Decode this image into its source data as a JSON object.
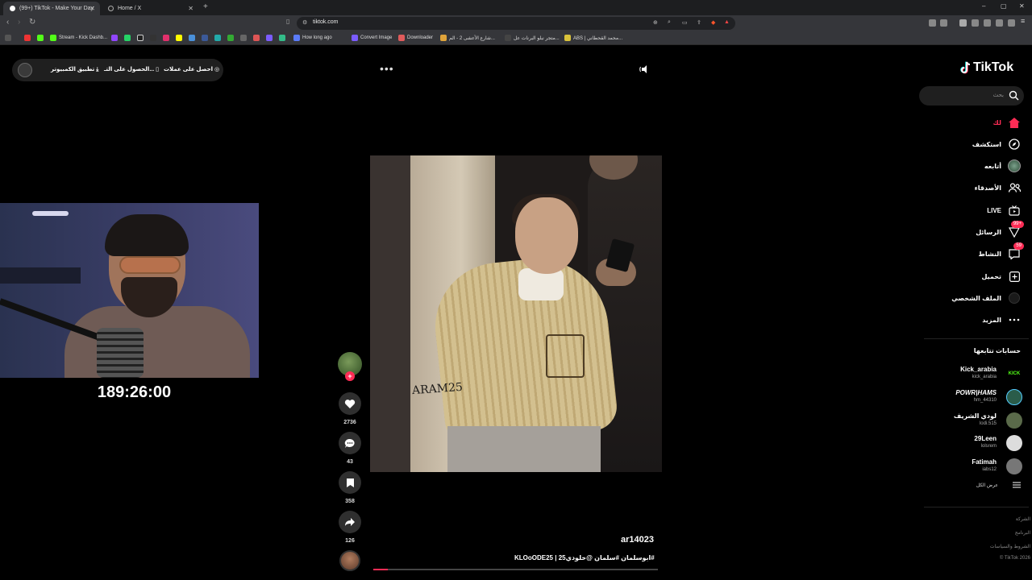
{
  "browser": {
    "tabs": [
      {
        "title": "(99+) TikTok - Make Your Day",
        "active": true
      },
      {
        "title": "Home / X",
        "active": false
      }
    ],
    "new_tab": "+",
    "window_controls": [
      "–",
      "▢",
      "✕"
    ],
    "url": "tiktok.com",
    "bookmarks": [
      {
        "label": "Stream - Kick Dashb...",
        "color": "#53fc18"
      },
      {
        "label": "How long ago",
        "color": "#5b7cfa"
      },
      {
        "label": "Convert Image",
        "color": "#7b5cff"
      },
      {
        "label": "Downloader",
        "color": "#e05b5b"
      },
      {
        "label": "شارع الأعشى 2 - الم...",
        "color": "#e0a43a"
      },
      {
        "label": "متجر نبلو البرنات عل...",
        "color": "#444444"
      },
      {
        "label": "ABS | محمد القحطاني...",
        "color": "#d9c23a"
      }
    ]
  },
  "topbar": {
    "get_coins": "احصل على عملات",
    "get_app": "الحصول على التـ...",
    "desktop_app": "تطبيق الكمبيوتر",
    "more_dots": "•••"
  },
  "video": {
    "watermark": "ARAM25",
    "author": "ar14023",
    "caption": "#ابوسلمان #سلمان @خلودي25 | KLOoODE25",
    "progress": 0.05
  },
  "actions": {
    "likes": "2736",
    "comments": "43",
    "saves": "358",
    "shares": "126",
    "follow_plus": "+"
  },
  "webcam": {
    "timer": "189:26:00"
  },
  "sidebar": {
    "logo": "TikTok",
    "search_placeholder": "بحث",
    "nav": [
      {
        "label": "لك",
        "icon": "home-icon",
        "active": true
      },
      {
        "label": "استكشف",
        "icon": "compass-icon",
        "active": false
      },
      {
        "label": "أتابعه",
        "icon": "avatar-icon",
        "active": false
      },
      {
        "label": "الأصدقاء",
        "icon": "friends-icon",
        "active": false
      },
      {
        "label": "LIVE",
        "icon": "live-icon",
        "active": false
      },
      {
        "label": "الرسائل",
        "icon": "messages-icon",
        "active": false,
        "badge": "99+"
      },
      {
        "label": "النشاط",
        "icon": "activity-icon",
        "active": false,
        "badge": "59"
      },
      {
        "label": "تحميل",
        "icon": "upload-icon",
        "active": false
      },
      {
        "label": "الملف الشخصي",
        "icon": "profile-icon",
        "active": false
      },
      {
        "label": "المزيد",
        "icon": "more-icon",
        "active": false
      }
    ],
    "following_title": "حسابات تتابعها",
    "following": [
      {
        "name": "Kick_arabia",
        "user": "kick_arabia",
        "avatar": "kick"
      },
      {
        "name": "POWR|HAMS",
        "user": "hm_44310",
        "avatar": "#2a5c4a"
      },
      {
        "name": "لودي الشريف",
        "user": "lodi.515",
        "avatar": "#5a6a4a"
      },
      {
        "name": "29Leen",
        "user": "lolsrem",
        "avatar": "#dddddd"
      },
      {
        "name": "Fatimah",
        "user": "iabs12",
        "avatar": "#777777"
      }
    ],
    "kick_text": "KICK",
    "see_all": "عرض الكل",
    "footer": [
      "الشركة",
      "البرنامج",
      "الشروط والسياسات",
      "© TikTok 2026"
    ]
  },
  "colors": {
    "accent": "#fe2c55",
    "background": "#000000",
    "kick_green": "#53fc18"
  }
}
